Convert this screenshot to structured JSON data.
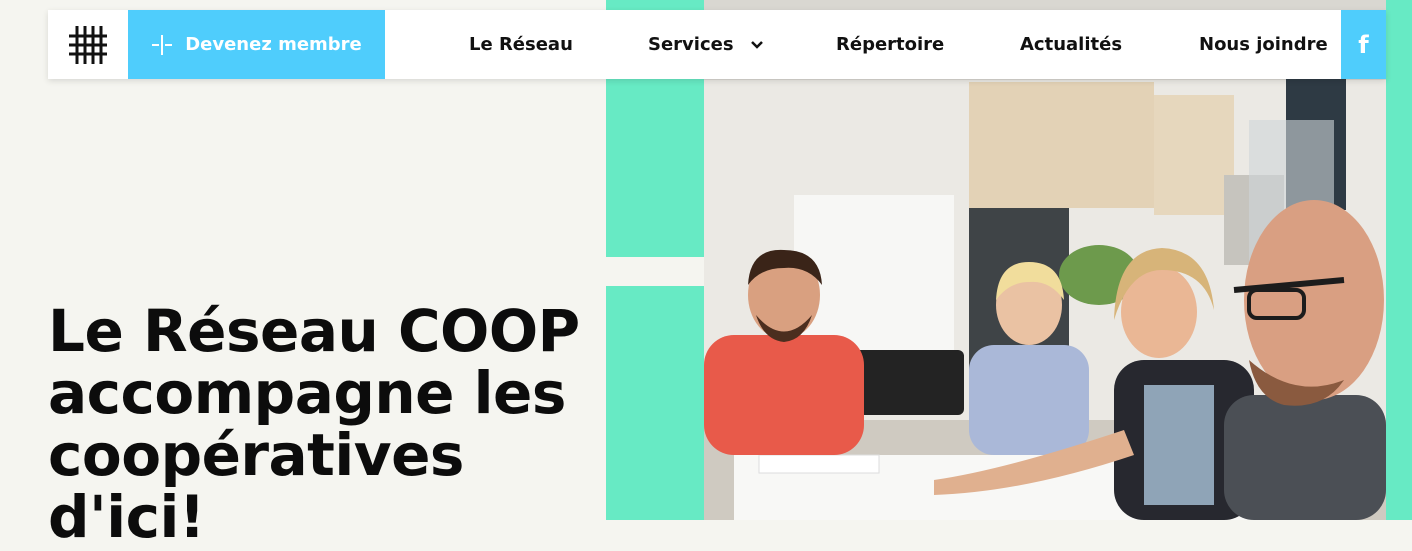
{
  "nav": {
    "member_label": "Devenez membre",
    "items": [
      {
        "label": "Le Réseau"
      },
      {
        "label": "Services"
      },
      {
        "label": "Répertoire"
      },
      {
        "label": "Actualités"
      },
      {
        "label": "Nous joindre"
      }
    ],
    "facebook_glyph": "f"
  },
  "hero": {
    "headline": "Le Réseau COOP accompagne les coopératives d'ici!"
  },
  "colors": {
    "accent_blue": "#4fcdfc",
    "accent_green": "#67eac4",
    "background": "#f5f5f0"
  }
}
